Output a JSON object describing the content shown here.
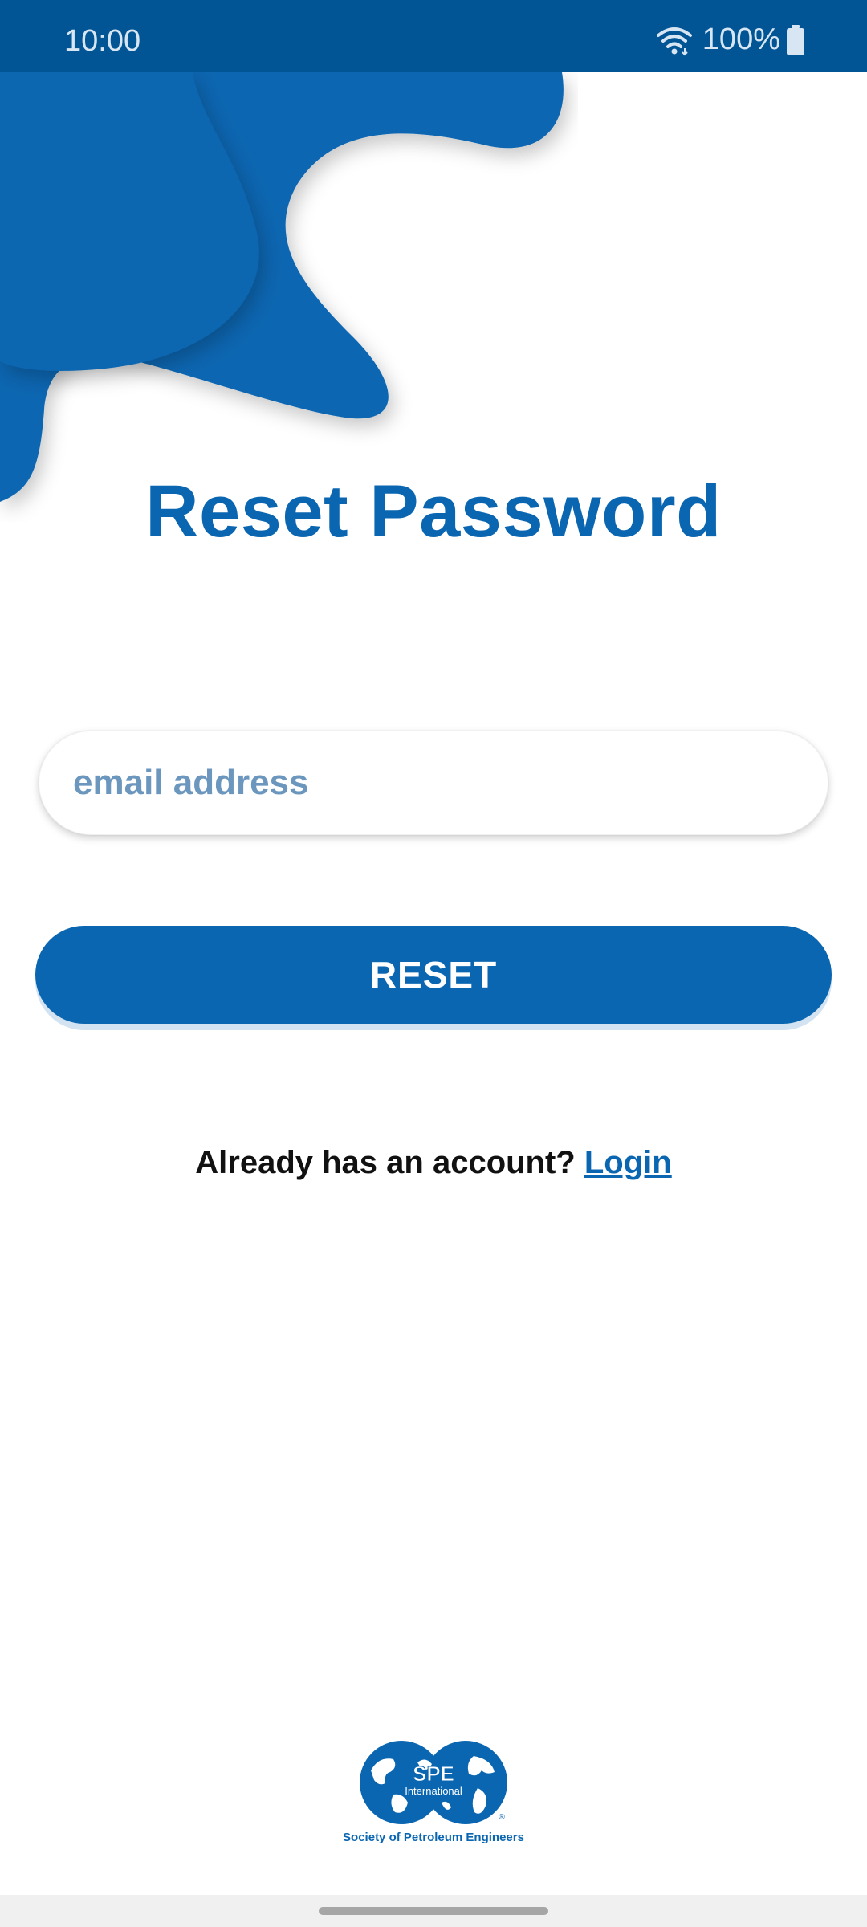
{
  "status_bar": {
    "time": "10:00",
    "battery": "100%",
    "icons": [
      "wifi-icon",
      "battery-icon"
    ]
  },
  "page": {
    "title": "Reset Password"
  },
  "form": {
    "email_placeholder": "email address",
    "email_value": "",
    "reset_label": "RESET"
  },
  "footer": {
    "prompt": "Already has an account?",
    "login_label": "Login"
  },
  "logo": {
    "name": "SPE",
    "subname": "International",
    "caption": "Society of Petroleum Engineers",
    "registered": "®"
  },
  "colors": {
    "primary": "#0a66b1",
    "status_bar": "#025594",
    "placeholder": "#6b96bd",
    "background": "#ffffff"
  }
}
